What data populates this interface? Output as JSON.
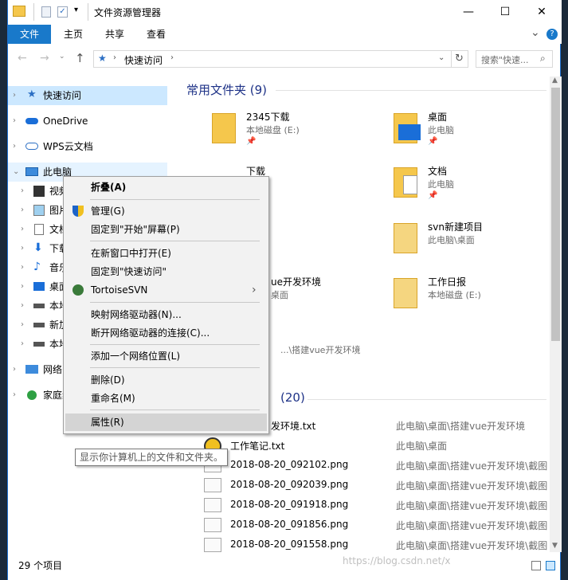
{
  "window": {
    "title": "文件资源管理器",
    "minimize_glyph": "—",
    "maximize_glyph": "☐",
    "close_glyph": "✕"
  },
  "ribbon": {
    "tabs": [
      "文件",
      "主页",
      "共享",
      "查看"
    ],
    "expand_glyph": "⌄",
    "help_glyph": "?"
  },
  "address": {
    "breadcrumb": [
      "快速访问"
    ],
    "search_placeholder": "搜索\"快速...",
    "back_glyph": "←",
    "forward_glyph": "→",
    "up_glyph": "↑",
    "refresh_glyph": "↻"
  },
  "nav": {
    "items": [
      {
        "label": "快速访问",
        "icon": "star-icon"
      },
      {
        "label": "OneDrive",
        "icon": "cloud-icon"
      },
      {
        "label": "WPS云文档",
        "icon": "cloud-outline-icon"
      },
      {
        "label": "此电脑",
        "icon": "pc-icon"
      },
      {
        "label": "视频",
        "icon": "video-icon"
      },
      {
        "label": "图片",
        "icon": "picture-icon"
      },
      {
        "label": "文档",
        "icon": "document-icon"
      },
      {
        "label": "下载",
        "icon": "download-icon"
      },
      {
        "label": "音乐",
        "icon": "music-icon"
      },
      {
        "label": "桌面",
        "icon": "desktop-icon"
      },
      {
        "label": "本地",
        "icon": "drive-icon"
      },
      {
        "label": "新加",
        "icon": "drive-icon"
      },
      {
        "label": "本地",
        "icon": "drive-icon"
      },
      {
        "label": "网络",
        "icon": "network-icon"
      },
      {
        "label": "家庭组",
        "icon": "homegroup-icon"
      }
    ]
  },
  "content": {
    "frequent_header": "常用文件夹 (9)",
    "folders": [
      {
        "name": "2345下载",
        "sub": "本地磁盘 (E:)"
      },
      {
        "name": "桌面",
        "sub": "此电脑"
      },
      {
        "name": "下载",
        "sub": ""
      },
      {
        "name": "文档",
        "sub": "此电脑"
      },
      {
        "name": "",
        "sub": ""
      },
      {
        "name": "svn新建项目",
        "sub": "此电脑\\桌面"
      },
      {
        "name": "ue开发环境",
        "sub": "桌面"
      },
      {
        "name": "工作日报",
        "sub": "本地磁盘 (E:)"
      },
      {
        "name": "",
        "sub": "...\\搭建vue开发环境"
      }
    ],
    "recent_header": "(20)",
    "recent_files": [
      {
        "name": "发环境.txt",
        "path": "此电脑\\桌面\\搭建vue开发环境"
      },
      {
        "name": "工作笔记.txt",
        "path": "此电脑\\桌面"
      },
      {
        "name": "2018-08-20_092102.png",
        "path": "此电脑\\桌面\\搭建vue开发环境\\截图"
      },
      {
        "name": "2018-08-20_092039.png",
        "path": "此电脑\\桌面\\搭建vue开发环境\\截图"
      },
      {
        "name": "2018-08-20_091918.png",
        "path": "此电脑\\桌面\\搭建vue开发环境\\截图"
      },
      {
        "name": "2018-08-20_091856.png",
        "path": "此电脑\\桌面\\搭建vue开发环境\\截图"
      },
      {
        "name": "2018-08-20_091558.png",
        "path": "此电脑\\桌面\\搭建vue开发环境\\截图"
      }
    ]
  },
  "status": {
    "count": "29 个项目"
  },
  "context_menu": {
    "items": [
      {
        "label": "折叠(A)",
        "bold": true
      },
      {
        "label": "管理(G)",
        "icon": "shield-icon"
      },
      {
        "label": "固定到\"开始\"屏幕(P)"
      },
      {
        "label": "在新窗口中打开(E)"
      },
      {
        "label": "固定到\"快速访问\""
      },
      {
        "label": "TortoiseSVN",
        "icon": "tortoise-icon",
        "submenu": "›"
      },
      {
        "label": "映射网络驱动器(N)..."
      },
      {
        "label": "断开网络驱动器的连接(C)..."
      },
      {
        "label": "添加一个网络位置(L)"
      },
      {
        "label": "删除(D)"
      },
      {
        "label": "重命名(M)"
      },
      {
        "label": "属性(R)",
        "highlighted": true
      }
    ]
  },
  "tooltip": "显示你计算机上的文件和文件夹。",
  "watermark": "https://blog.csdn.net/x",
  "colors": {
    "accent": "#1979ca",
    "header_blue": "#1e3287",
    "folder_yellow": "#f5c74c"
  }
}
